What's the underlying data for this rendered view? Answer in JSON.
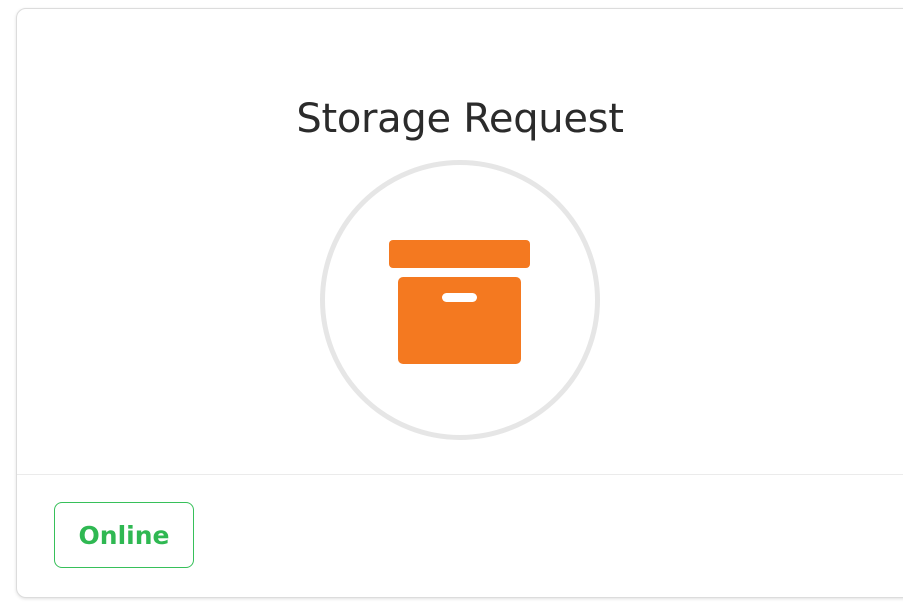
{
  "card": {
    "title": "Storage Request",
    "icon": "archive-box-icon",
    "status": "Online"
  },
  "colors": {
    "icon_orange": "#f47920",
    "circle_gray": "#e6e6e6",
    "status_green": "#2fb852",
    "title_text": "#2b2b2b"
  }
}
